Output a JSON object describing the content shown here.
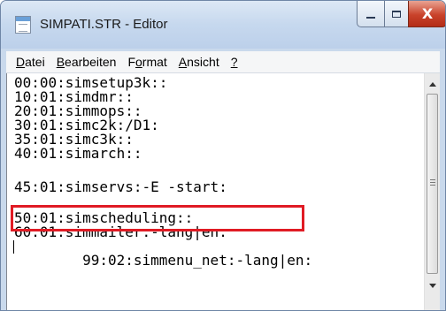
{
  "window": {
    "title": "SIMPATI.STR - Editor",
    "close_symbol": "X",
    "icons": [
      "notepad-icon",
      "minimize-icon",
      "maximize-icon",
      "close-icon"
    ]
  },
  "menu": {
    "items": [
      {
        "ul": "D",
        "rest": "atei"
      },
      {
        "ul": "B",
        "rest": "earbeiten"
      },
      {
        "pre": "F",
        "ul": "o",
        "rest": "rmat"
      },
      {
        "ul": "A",
        "rest": "nsicht"
      },
      {
        "ul": "?",
        "rest": ""
      }
    ]
  },
  "editor": {
    "lines": [
      "00:00:simsetup3k::",
      "10:01:simdmr::",
      "20:01:simmops::",
      "30:01:simc2k:/D1:",
      "35:01:simc3k::",
      "40:01:simarch::",
      "",
      "45:01:simservs:-E -start:",
      "",
      "50:01:simscheduling::",
      "60:01:simmailer:-lang|en:",
      "99:02:simmenu_net:-lang|en:"
    ],
    "highlight_color": "#e01b24"
  }
}
